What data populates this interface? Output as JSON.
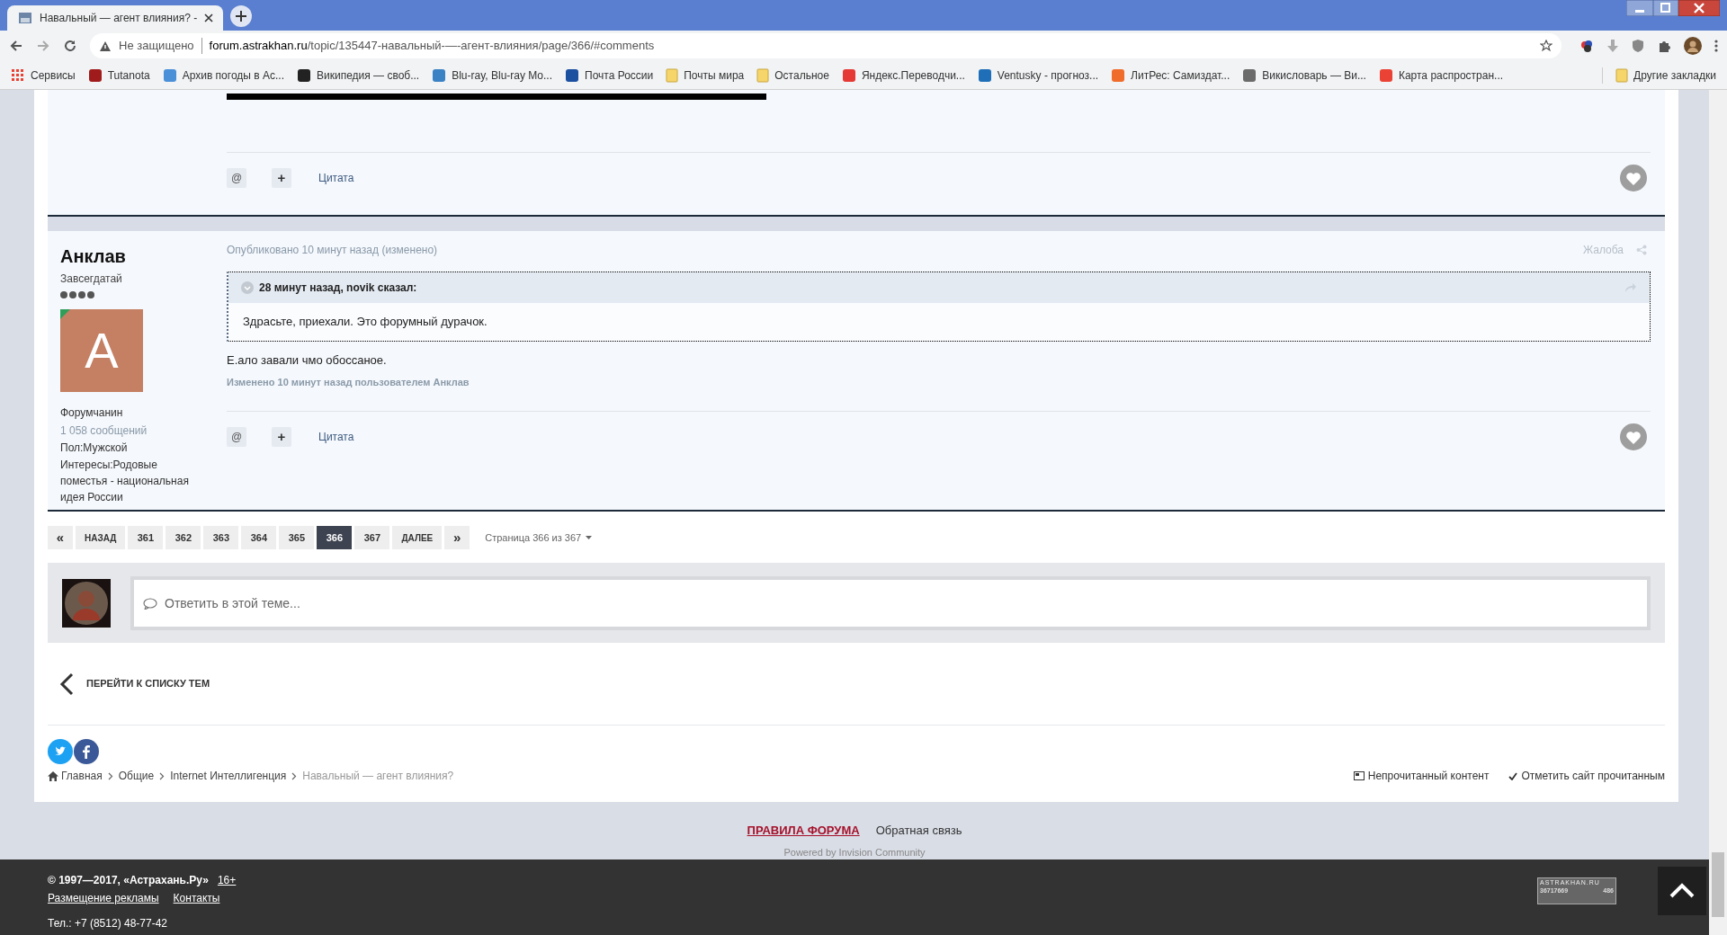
{
  "browser": {
    "tab": {
      "title": "Навальный — агент влияния? -",
      "selected": true
    },
    "security": "Не защищено",
    "url_host": "forum.astrakhan.ru",
    "url_path": "/topic/135447-навальный-—-агент-влияния/page/366/#comments",
    "bookmarks": [
      {
        "label": "Сервисы",
        "kind": "apps",
        "color": "#e94235"
      },
      {
        "label": "Tutanota",
        "kind": "site",
        "color": "#a01c1c"
      },
      {
        "label": "Архив погоды в Ас...",
        "kind": "site",
        "color": "#4a90d9"
      },
      {
        "label": "Википедия — своб...",
        "kind": "site",
        "color": "#222222"
      },
      {
        "label": "Blu-ray, Blu-ray Mo...",
        "kind": "site",
        "color": "#3b82c4"
      },
      {
        "label": "Почта России",
        "kind": "site",
        "color": "#1b4fa0"
      },
      {
        "label": "Почты мира",
        "kind": "folder",
        "color": "#f6d66b"
      },
      {
        "label": "Остальное",
        "kind": "folder",
        "color": "#f6d66b"
      },
      {
        "label": "Яндекс.Переводчи...",
        "kind": "site",
        "color": "#e53935"
      },
      {
        "label": "Ventusky - прогноз...",
        "kind": "site",
        "color": "#1e6fb8"
      },
      {
        "label": "ЛитРес: Самиздат...",
        "kind": "site",
        "color": "#ef6c2b"
      },
      {
        "label": "Викисловарь — Ви...",
        "kind": "site",
        "color": "#6b6b6b"
      },
      {
        "label": "Карта распростран...",
        "kind": "site",
        "color": "#ea4335"
      }
    ],
    "other_bookmarks": "Другие закладки"
  },
  "previous_post": {
    "actions": {
      "mention": "@",
      "add": "+",
      "quote": "Цитата"
    }
  },
  "post": {
    "author": "Анклав",
    "rank": "Завсегдатай",
    "stars": 4,
    "avatar_letter": "A",
    "online": true,
    "group": "Форумчанин",
    "posts_count": "1 058 сообщений",
    "fields": [
      "Пол:Мужской",
      "Интересы:Родовые поместья - национальная идея России"
    ],
    "meta": "Опубликовано 10 минут назад (изменено)",
    "report": "Жалоба",
    "quote": {
      "header": "28 минут назад, novik сказал:",
      "text": "Здрасьте, приехали. Это форумный дурачок."
    },
    "text": "Е.ало завали чмо обоссаное.",
    "edited": "Изменено 10 минут назад пользователем Анклав",
    "actions": {
      "mention": "@",
      "add": "+",
      "quote": "Цитата"
    }
  },
  "pagination": {
    "items": [
      {
        "label": "«",
        "kind": "arrow",
        "selected": false
      },
      {
        "label": "НАЗАД",
        "kind": "word",
        "selected": false
      },
      {
        "label": "361",
        "kind": "page",
        "selected": false
      },
      {
        "label": "362",
        "kind": "page",
        "selected": false
      },
      {
        "label": "363",
        "kind": "page",
        "selected": false
      },
      {
        "label": "364",
        "kind": "page",
        "selected": false
      },
      {
        "label": "365",
        "kind": "page",
        "selected": false
      },
      {
        "label": "366",
        "kind": "page",
        "selected": true
      },
      {
        "label": "367",
        "kind": "page",
        "selected": false
      },
      {
        "label": "ДАЛЕЕ",
        "kind": "word",
        "selected": false
      },
      {
        "label": "»",
        "kind": "arrow",
        "selected": false
      }
    ],
    "page_of": "Страница 366 из 367"
  },
  "reply": {
    "placeholder": "Ответить в этой теме..."
  },
  "back_link": "ПЕРЕЙТИ К СПИСКУ ТЕМ",
  "breadcrumb": [
    "Главная",
    "Общие",
    "Internet Интеллигенция",
    "Навальный — агент влияния?"
  ],
  "footer_actions": [
    "Непрочитанный контент",
    "Отметить сайт прочитанным"
  ],
  "footer_links": [
    {
      "label": "ПРАВИЛА ФОРУМА",
      "kind": "rules"
    },
    {
      "label": "Обратная связь",
      "kind": "plain"
    }
  ],
  "powered": "Powered by Invision Community",
  "site_footer": {
    "copyright": "© 1997—2017, «Астрахань.Ру»",
    "age": "16+",
    "links": [
      "Размещение рекламы",
      "Контакты"
    ],
    "phone": "Тел.: +7 (8512) 48-77-42",
    "counter": {
      "site": "ASTRAKHAN.RU",
      "total": "36717669",
      "today": "486"
    }
  }
}
